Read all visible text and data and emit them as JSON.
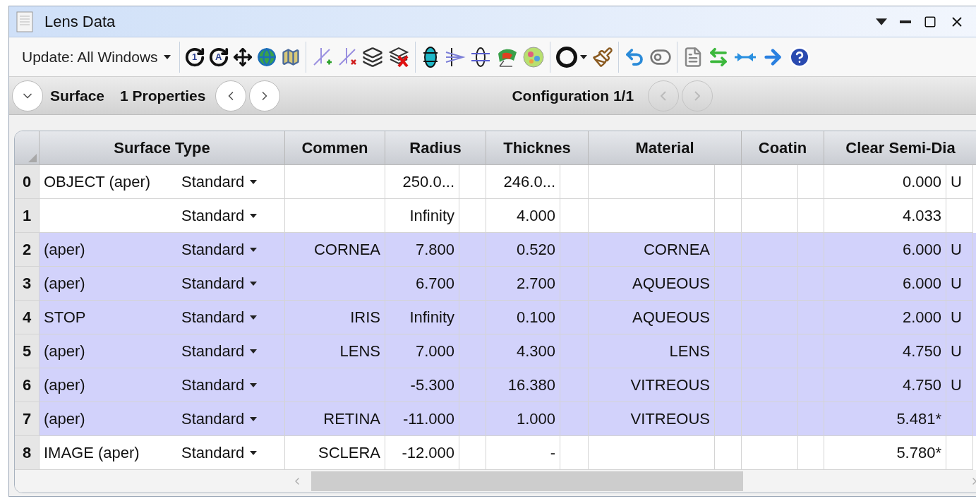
{
  "window": {
    "title": "Lens Data"
  },
  "toolbar": {
    "update_button": "Update: All Windows",
    "refresh_labels": [
      "1",
      "A"
    ]
  },
  "nav": {
    "surface_label": "Surface",
    "properties_label": "1 Properties",
    "configuration_label": "Configuration 1/1"
  },
  "table": {
    "columns": [
      "Surface Type",
      "Commen",
      "Radius",
      "Thicknes",
      "Material",
      "Coatin",
      "Clear Semi-Dia"
    ],
    "rows": [
      {
        "number": "0",
        "name": "OBJECT (aper)",
        "type": "Standard",
        "comment": "",
        "radius": "250.0...",
        "thickness": "246.0...",
        "material": "",
        "semi_dia": "0.000",
        "semi_dia_solve": "U",
        "highlighted": false
      },
      {
        "number": "1",
        "name": "",
        "type": "Standard",
        "comment": "",
        "radius": "Infinity",
        "thickness": "4.000",
        "material": "",
        "semi_dia": "4.033",
        "semi_dia_solve": "",
        "highlighted": false
      },
      {
        "number": "2",
        "name": "(aper)",
        "type": "Standard",
        "comment": "CORNEA",
        "radius": "7.800",
        "thickness": "0.520",
        "material": "CORNEA",
        "semi_dia": "6.000",
        "semi_dia_solve": "U",
        "highlighted": true
      },
      {
        "number": "3",
        "name": "(aper)",
        "type": "Standard",
        "comment": "",
        "radius": "6.700",
        "thickness": "2.700",
        "material": "AQUEOUS",
        "semi_dia": "6.000",
        "semi_dia_solve": "U",
        "highlighted": true
      },
      {
        "number": "4",
        "name": "STOP",
        "type": "Standard",
        "comment": "IRIS",
        "radius": "Infinity",
        "thickness": "0.100",
        "material": "AQUEOUS",
        "semi_dia": "2.000",
        "semi_dia_solve": "U",
        "highlighted": true
      },
      {
        "number": "5",
        "name": "(aper)",
        "type": "Standard",
        "comment": "LENS",
        "radius": "7.000",
        "thickness": "4.300",
        "material": "LENS",
        "semi_dia": "4.750",
        "semi_dia_solve": "U",
        "highlighted": true
      },
      {
        "number": "6",
        "name": "(aper)",
        "type": "Standard",
        "comment": "",
        "radius": "-5.300",
        "thickness": "16.380",
        "material": "VITREOUS",
        "semi_dia": "4.750",
        "semi_dia_solve": "U",
        "highlighted": true
      },
      {
        "number": "7",
        "name": "(aper)",
        "type": "Standard",
        "comment": "RETINA",
        "radius": "-11.000",
        "thickness": "1.000",
        "material": "VITREOUS",
        "semi_dia": "5.481*",
        "semi_dia_solve": "",
        "highlighted": true
      },
      {
        "number": "8",
        "name": "IMAGE (aper)",
        "type": "Standard",
        "comment": "SCLERA",
        "radius": "-12.000",
        "thickness": "-",
        "material": "",
        "semi_dia": "5.780*",
        "semi_dia_solve": "",
        "highlighted": false
      }
    ]
  }
}
